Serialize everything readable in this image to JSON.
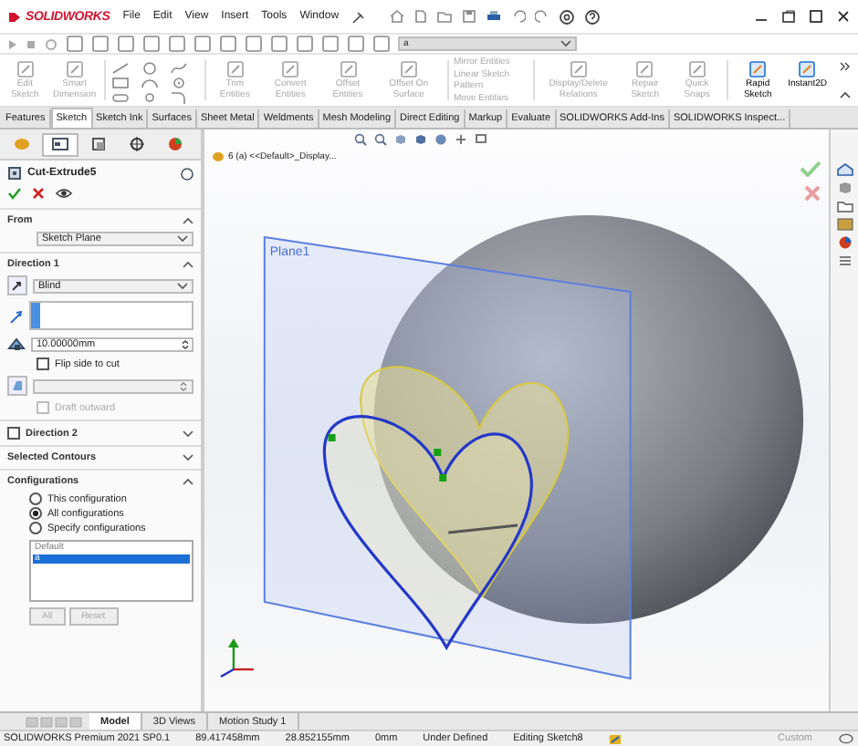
{
  "title_bar": {
    "logo": "SOLIDWORKS",
    "menu": [
      "File",
      "Edit",
      "View",
      "Insert",
      "Tools",
      "Window"
    ]
  },
  "toolbar": {
    "configuration": "a"
  },
  "ribbon": {
    "commands": [
      {
        "kind": "large",
        "label": "Edit Sketch",
        "disabled": true
      },
      {
        "kind": "large",
        "label": "Smart Dimension",
        "disabled": true
      },
      {
        "kind": "tools"
      },
      {
        "kind": "large",
        "label": "Trim Entities",
        "disabled": true
      },
      {
        "kind": "large",
        "label": "Convert Entities",
        "disabled": true
      },
      {
        "kind": "large",
        "label": "Offset Entities",
        "disabled": true
      },
      {
        "kind": "large",
        "label": "Offset On Surface",
        "disabled": true
      },
      {
        "kind": "stack",
        "items": [
          "Mirror Entities",
          "Linear Sketch Pattern",
          "Move Entities"
        ],
        "disabled": true
      },
      {
        "kind": "large",
        "label": "Display/Delete Relations",
        "disabled": true
      },
      {
        "kind": "large",
        "label": "Repair Sketch",
        "disabled": true
      },
      {
        "kind": "large",
        "label": "Quick Snaps",
        "disabled": true
      },
      {
        "kind": "large",
        "label": "Rapid Sketch",
        "disabled": false
      },
      {
        "kind": "large",
        "label": "Instant2D",
        "disabled": false
      }
    ]
  },
  "ribbon_tabs": [
    {
      "label": "Features",
      "selected": false
    },
    {
      "label": "Sketch",
      "selected": true
    },
    {
      "label": "Sketch Ink",
      "selected": false
    },
    {
      "label": "Surfaces",
      "selected": false
    },
    {
      "label": "Sheet Metal",
      "selected": false
    },
    {
      "label": "Weldments",
      "selected": false
    },
    {
      "label": "Mesh Modeling",
      "selected": false
    },
    {
      "label": "Direct Editing",
      "selected": false
    },
    {
      "label": "Markup",
      "selected": false
    },
    {
      "label": "Evaluate",
      "selected": false
    },
    {
      "label": "SOLIDWORKS Add-Ins",
      "selected": false
    },
    {
      "label": "SOLIDWORKS Inspect...",
      "selected": false
    }
  ],
  "property_manager": {
    "tabs": [
      {
        "kind": "feature",
        "selected": false
      },
      {
        "kind": "property",
        "selected": true
      },
      {
        "kind": "config",
        "selected": false
      },
      {
        "kind": "target",
        "selected": false
      },
      {
        "kind": "appearance",
        "selected": false
      }
    ],
    "title": "Cut-Extrude5",
    "sections": [
      {
        "kind": "from",
        "title": "From",
        "expanded": true,
        "start": "Sketch Plane"
      },
      {
        "kind": "direction",
        "title": "Direction 1",
        "expanded": true,
        "end_condition": "Blind",
        "depth": "10.00000mm",
        "flip": {
          "label": "Flip side to cut",
          "checked": false
        },
        "draft": {
          "label": "Draft outward",
          "checked": false,
          "disabled": true
        }
      },
      {
        "kind": "checkable",
        "title": "Direction 2",
        "checked": false,
        "expanded": false
      },
      {
        "kind": "plain",
        "title": "Selected Contours",
        "expanded": false
      },
      {
        "kind": "configurations",
        "title": "Configurations",
        "expanded": true,
        "options": [
          {
            "label": "This configuration",
            "selected": false
          },
          {
            "label": "All configurations",
            "selected": true
          },
          {
            "label": "Specify configurations",
            "selected": false
          }
        ],
        "list": [
          {
            "label": "Default",
            "selected": false
          },
          {
            "label": "a",
            "selected": true
          }
        ],
        "buttons": [
          {
            "label": "All",
            "disabled": true
          },
          {
            "label": "Reset",
            "disabled": true
          }
        ]
      }
    ]
  },
  "viewport": {
    "document": "6 (a) <<Default>_Display...",
    "plane_label": "Plane1"
  },
  "bottom_tabs": [
    {
      "label": "Model",
      "selected": true
    },
    {
      "label": "3D Views",
      "selected": false
    },
    {
      "label": "Motion Study 1",
      "selected": false
    }
  ],
  "status_bar": {
    "product": "SOLIDWORKS Premium 2021 SP0.1",
    "fields": [
      "89.417458mm",
      "28.852155mm",
      "0mm",
      "Under Defined",
      "Editing Sketch8"
    ],
    "units": "Custom"
  }
}
